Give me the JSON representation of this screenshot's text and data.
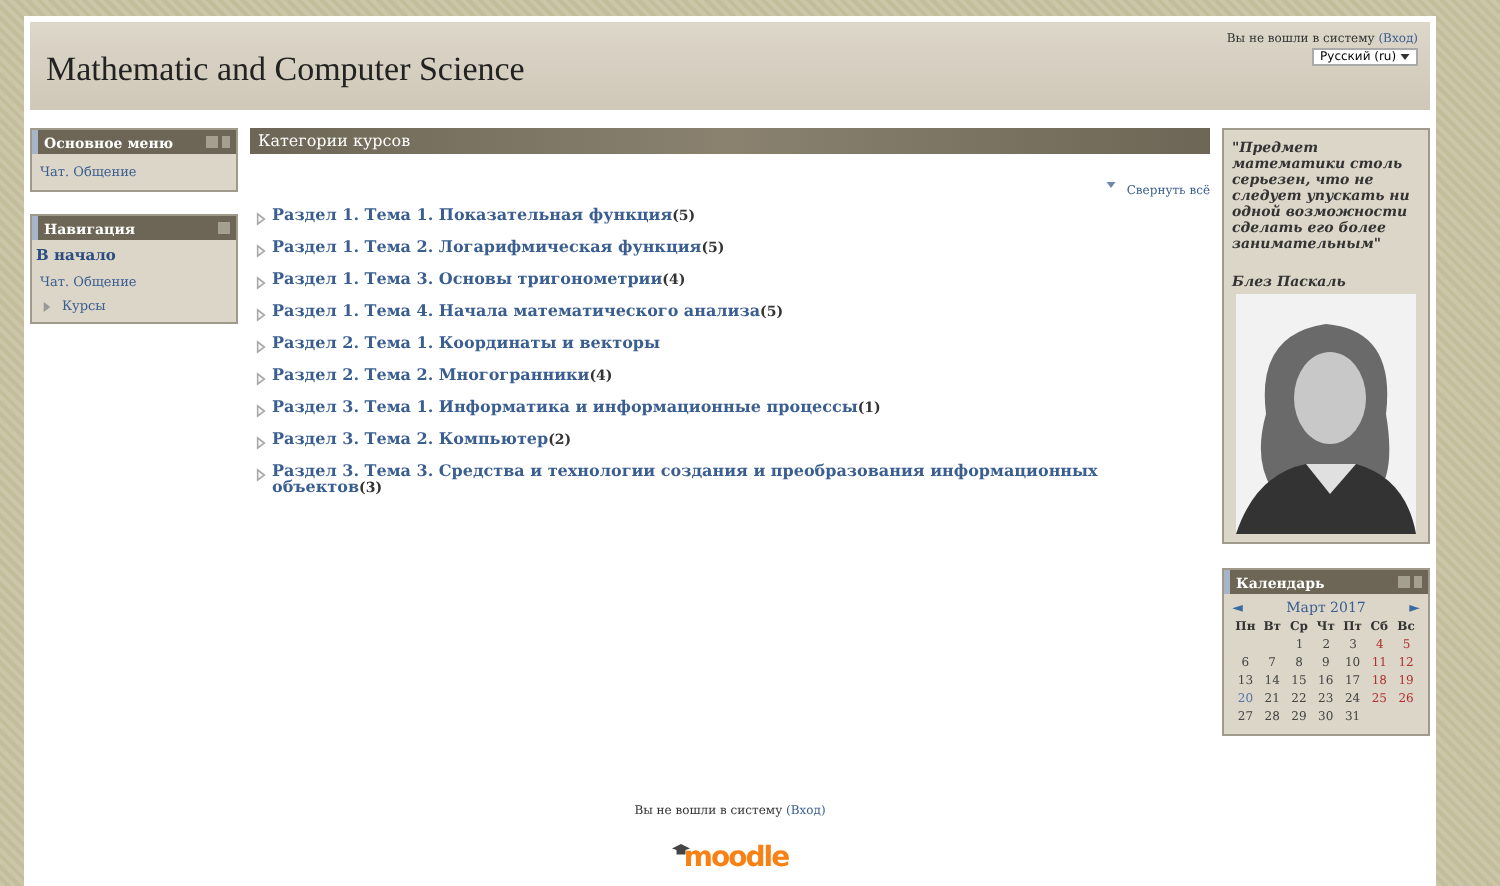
{
  "header": {
    "title": "Mathematic and Computer Science",
    "login_text": "Вы не вошли в систему",
    "login_link": "(Вход)",
    "language": "Русский (ru)"
  },
  "left_blocks": [
    {
      "title": "Основное меню",
      "items": [
        {
          "kind": "chat",
          "label": "Чат. Общение"
        }
      ]
    },
    {
      "title": "Навигация",
      "items": [
        {
          "kind": "home",
          "label": "В начало"
        },
        {
          "kind": "chat",
          "label": "Чат. Общение"
        },
        {
          "kind": "branch",
          "label": "Курсы"
        }
      ]
    }
  ],
  "main": {
    "title": "Категории курсов",
    "collapse_link": "Свернуть всё",
    "categories": [
      {
        "name": "Раздел 1. Тема 1. Показательная функция",
        "count": "(5)"
      },
      {
        "name": "Раздел 1. Тема 2. Логарифмическая функция",
        "count": "(5)"
      },
      {
        "name": "Раздел 1. Тема 3. Основы тригонометрии",
        "count": "(4)"
      },
      {
        "name": "Раздел 1. Тема 4. Начала математического анализа",
        "count": "(5)"
      },
      {
        "name": "Раздел 2. Тема 1. Координаты и векторы"
      },
      {
        "name": "Раздел 2. Тема 2. Многогранники",
        "count": "(4)"
      },
      {
        "name": "Раздел 3. Тема 1. Информатика и информационные процессы",
        "count": "(1)"
      },
      {
        "name": "Раздел 3. Тема 2. Компьютер",
        "count": "(2)"
      },
      {
        "name": "Раздел 3. Тема 3. Средства и технологии создания и преобразования информационных объектов",
        "count": "(3)"
      }
    ]
  },
  "quote": {
    "text": "\"Предмет математики столь серьезен, что не следует упускать ни одной возможности сделать его более занимательным\"",
    "author": "Блез Паскаль"
  },
  "calendar": {
    "title": "Календарь",
    "month": "Март 2017",
    "prev": "◄",
    "next": "►",
    "weekdays": [
      "Пн",
      "Вт",
      "Ср",
      "Чт",
      "Пт",
      "Сб",
      "Вс"
    ],
    "weeks": [
      [
        {
          "day": "1",
          "kind": "weekday"
        },
        {
          "day": "2",
          "kind": "weekday"
        },
        {
          "day": "3",
          "kind": "weekday"
        },
        {
          "day": "4",
          "kind": "weekend"
        },
        {
          "day": "5",
          "kind": "weekend"
        }
      ],
      [
        {
          "day": "6",
          "kind": "weekday"
        },
        {
          "day": "7",
          "kind": "weekday"
        },
        {
          "day": "8",
          "kind": "weekday"
        },
        {
          "day": "9",
          "kind": "weekday"
        },
        {
          "day": "10",
          "kind": "weekday"
        },
        {
          "day": "11",
          "kind": "weekend"
        },
        {
          "day": "12",
          "kind": "weekend"
        }
      ],
      [
        {
          "day": "13",
          "kind": "weekday"
        },
        {
          "day": "14",
          "kind": "weekday"
        },
        {
          "day": "15",
          "kind": "weekday"
        },
        {
          "day": "16",
          "kind": "weekday"
        },
        {
          "day": "17",
          "kind": "weekday"
        },
        {
          "day": "18",
          "kind": "weekend"
        },
        {
          "day": "19",
          "kind": "weekend"
        }
      ],
      [
        {
          "day": "20",
          "kind": "today"
        },
        {
          "day": "21",
          "kind": "weekday"
        },
        {
          "day": "22",
          "kind": "weekday"
        },
        {
          "day": "23",
          "kind": "weekday"
        },
        {
          "day": "24",
          "kind": "weekday"
        },
        {
          "day": "25",
          "kind": "weekend"
        },
        {
          "day": "26",
          "kind": "weekend"
        }
      ],
      [
        {
          "day": "27",
          "kind": "weekday"
        },
        {
          "day": "28",
          "kind": "weekday"
        },
        {
          "day": "29",
          "kind": "weekday"
        },
        {
          "day": "30",
          "kind": "weekday"
        },
        {
          "day": "31",
          "kind": "weekday"
        }
      ]
    ]
  },
  "footer": {
    "login_text": "Вы не вошли в систему",
    "login_link": "(Вход)",
    "logo": "moodle"
  }
}
